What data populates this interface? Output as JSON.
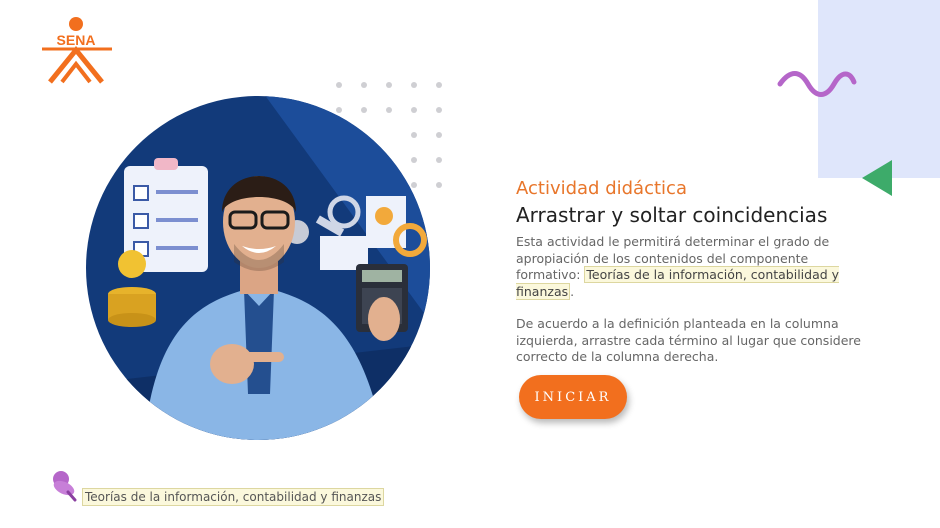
{
  "logo": {
    "text": "SENA",
    "color": "#f26f1e"
  },
  "hero": {
    "alt": "Hombre sonriente señalando, con calculadora y gráficos financieros"
  },
  "activity": {
    "kicker": "Actividad didáctica",
    "title": "Arrastrar y soltar coincidencias",
    "intro": "Esta actividad le permitirá determinar el grado de apropiación de los contenidos del componente formativo:",
    "component_name": "Teorías de la información, contabilidad y finanzas",
    "period": ".",
    "instructions": "De acuerdo a la definición planteada en la columna izquierda, arrastre cada término al lugar que considere correcto de la columna derecha."
  },
  "start_button": {
    "label": "INICIAR"
  },
  "footer": {
    "text": "Teorías de la información, contabilidad y finanzas",
    "icon": "pushpin-icon"
  },
  "colors": {
    "accent": "#f26f1e",
    "panel": "#dfe6fb",
    "squiggle": "#b566c9",
    "triangle": "#3dab6a"
  }
}
